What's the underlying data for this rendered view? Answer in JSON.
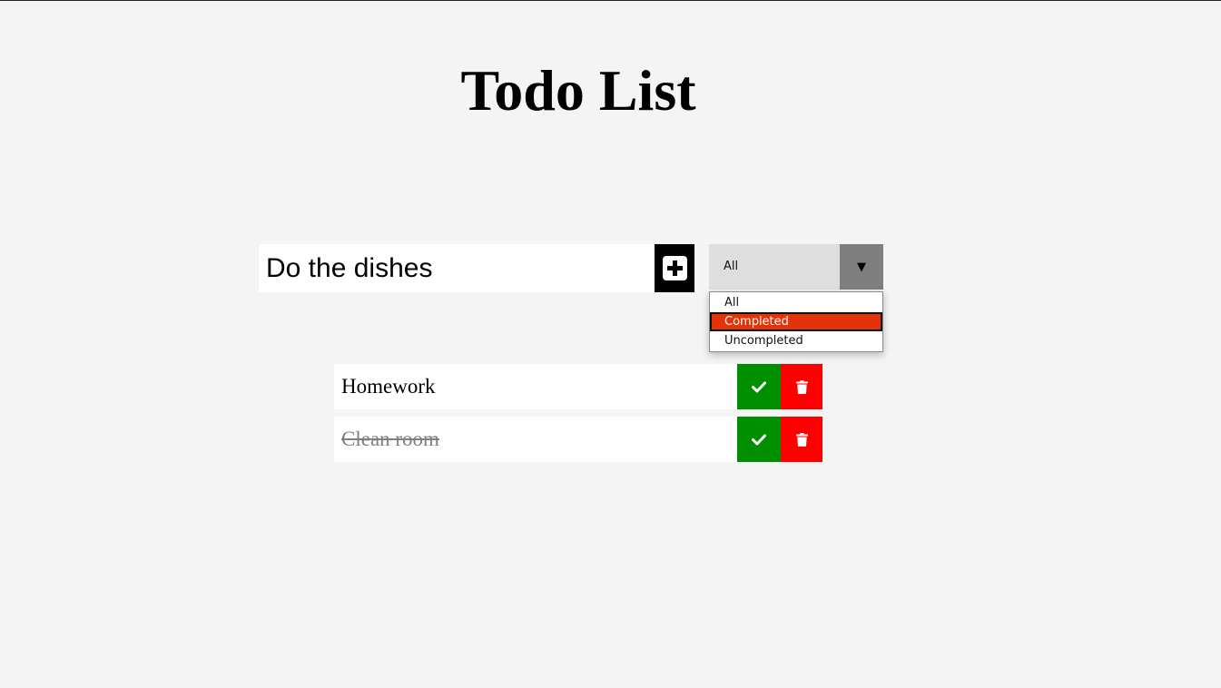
{
  "header": {
    "title": "Todo List"
  },
  "form": {
    "input_value": "Do the dishes",
    "add_icon": "plus-square-icon"
  },
  "filter": {
    "selected": "All",
    "arrow": "▼",
    "options": [
      {
        "label": "All",
        "highlighted": false
      },
      {
        "label": "Completed",
        "highlighted": true
      },
      {
        "label": "Uncompleted",
        "highlighted": false
      }
    ],
    "highlight_color": "#e2330a"
  },
  "todos": [
    {
      "text": "Homework",
      "completed": false
    },
    {
      "text": "Clean room",
      "completed": true
    }
  ],
  "colors": {
    "complete_button": "#008f00",
    "delete_button": "#ff0000",
    "background": "#f4f4f4"
  },
  "icons": {
    "complete": "check-icon",
    "delete": "trash-icon"
  }
}
